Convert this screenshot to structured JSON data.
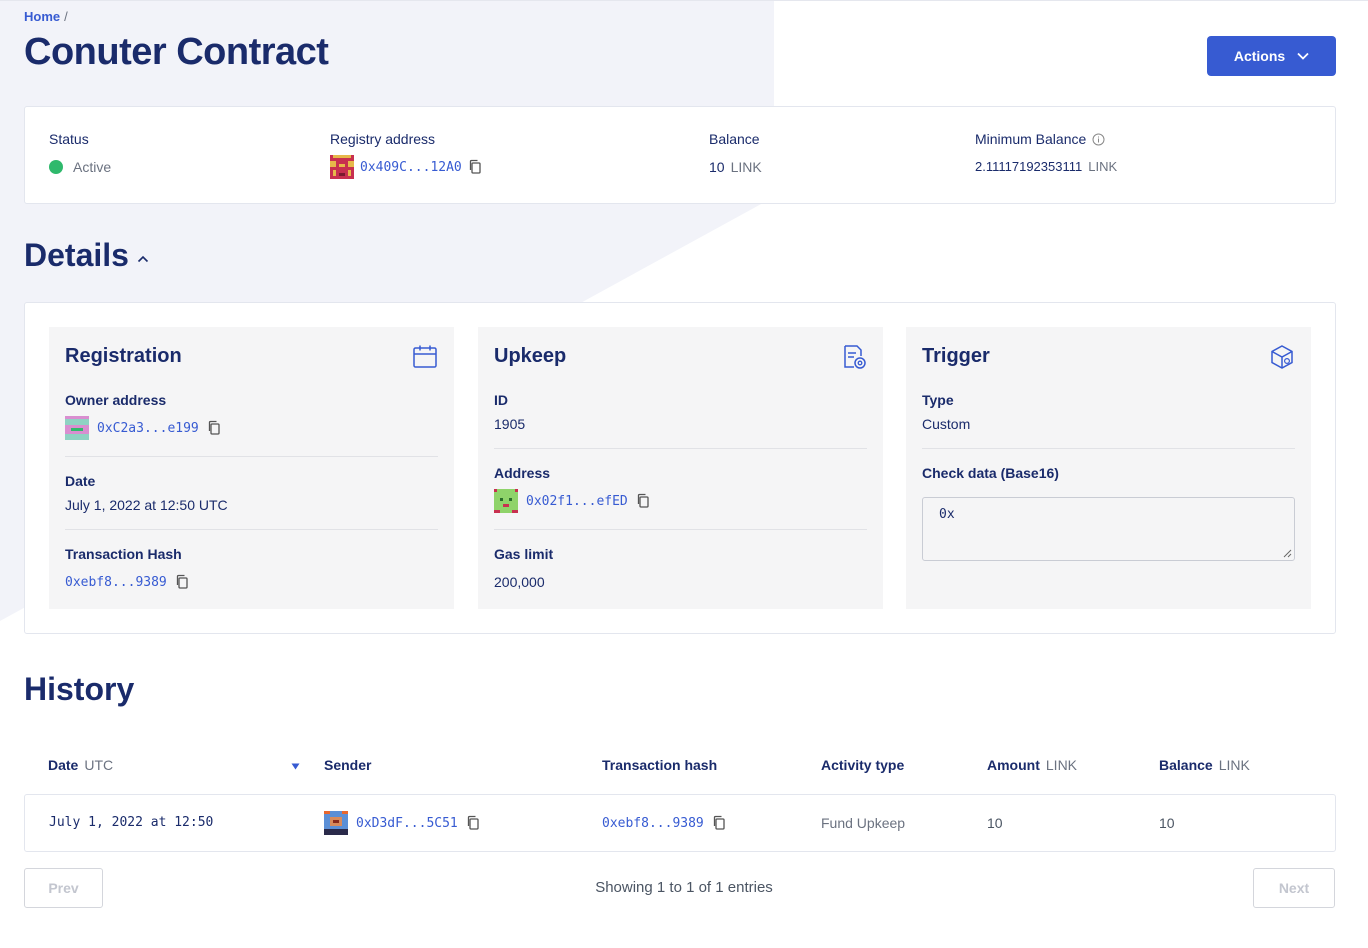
{
  "breadcrumb": {
    "home": "Home",
    "separator": "/"
  },
  "page": {
    "title": "Conuter Contract"
  },
  "actions": {
    "label": "Actions",
    "icon": "chevron-down-icon"
  },
  "summary": {
    "status": {
      "label": "Status",
      "value": "Active",
      "color": "#2fb96c"
    },
    "registry": {
      "label": "Registry address",
      "value": "0x409C...12A0"
    },
    "balance": {
      "label": "Balance",
      "amount": "10",
      "unit": "LINK"
    },
    "min_balance": {
      "label": "Minimum Balance",
      "amount": "2.11117192353111",
      "unit": "LINK"
    }
  },
  "details": {
    "title": "Details",
    "registration": {
      "title": "Registration",
      "icon": "calendar-icon",
      "owner_label": "Owner address",
      "owner_value": "0xC2a3...e199",
      "date_label": "Date",
      "date_value": "July 1, 2022 at 12:50 UTC",
      "tx_label": "Transaction Hash",
      "tx_value": "0xebf8...9389"
    },
    "upkeep": {
      "title": "Upkeep",
      "icon": "document-settings-icon",
      "id_label": "ID",
      "id_value": "1905",
      "address_label": "Address",
      "address_value": "0x02f1...efED",
      "gas_label": "Gas limit",
      "gas_value": "200,000"
    },
    "trigger": {
      "title": "Trigger",
      "icon": "cube-icon",
      "type_label": "Type",
      "type_value": "Custom",
      "check_label": "Check data (Base16)",
      "check_value": "0x"
    }
  },
  "history": {
    "title": "History",
    "columns": {
      "date": "Date",
      "date_sub": "UTC",
      "sender": "Sender",
      "tx": "Transaction hash",
      "activity": "Activity type",
      "amount": "Amount",
      "amount_sub": "LINK",
      "balance": "Balance",
      "balance_sub": "LINK"
    },
    "rows": [
      {
        "date": "July 1, 2022 at 12:50",
        "sender": "0xD3dF...5C51",
        "tx": "0xebf8...9389",
        "activity": "Fund Upkeep",
        "amount": "10",
        "balance": "10"
      }
    ]
  },
  "pagination": {
    "prev": "Prev",
    "next": "Next",
    "info": "Showing 1 to 1 of 1 entries"
  },
  "colors": {
    "primary": "#375bd2",
    "heading": "#1a2b6b",
    "active": "#2fb96c"
  }
}
